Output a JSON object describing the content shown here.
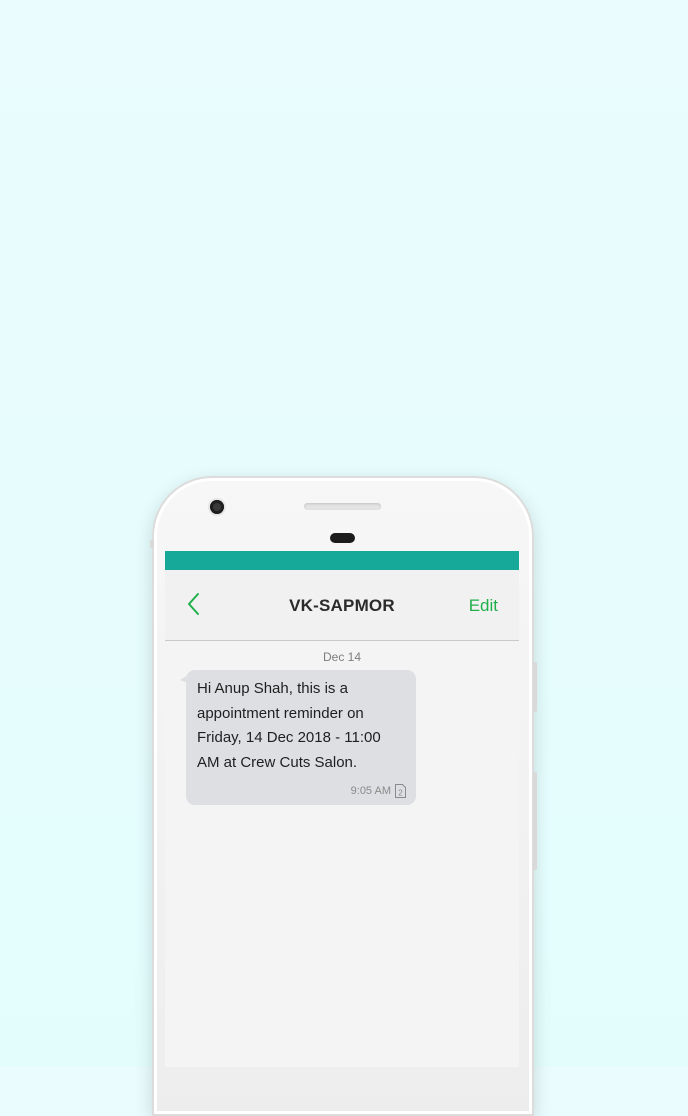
{
  "header": {
    "back_icon": "chevron-left-icon",
    "title": "VK-SAPMOR",
    "edit_label": "Edit"
  },
  "conversation": {
    "date_separator": "Dec 14",
    "messages": [
      {
        "text": "Hi Anup Shah, this is a appointment reminder on Friday, 14 Dec 2018 - 11:00 AM at Crew Cuts Salon.",
        "time": "9:05 AM",
        "sim_icon": "sim-2-icon",
        "sim_label": "2"
      }
    ]
  },
  "colors": {
    "status_bar": "#16a898",
    "accent": "#20b04b",
    "bubble": "#dddfe2"
  }
}
